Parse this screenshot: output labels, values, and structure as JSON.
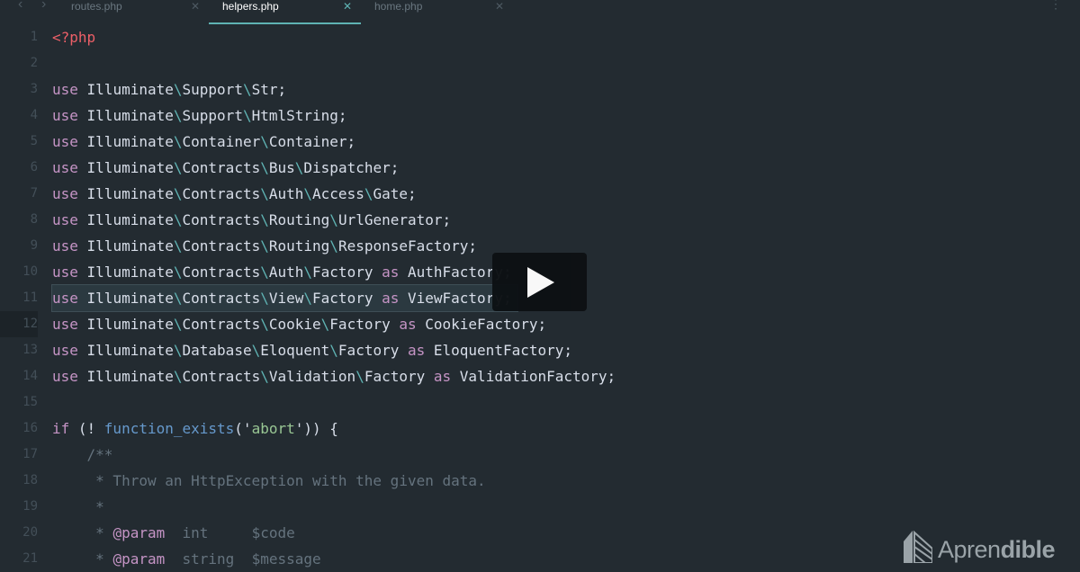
{
  "tabs": [
    {
      "label": "routes.php",
      "active": false
    },
    {
      "label": "helpers.php",
      "active": true
    },
    {
      "label": "home.php",
      "active": false
    }
  ],
  "icons": {
    "back": "chevron-left-icon",
    "forward": "chevron-right-icon",
    "close": "close-icon",
    "menu": "more-vertical-icon",
    "play": "play-icon"
  },
  "colors": {
    "background": "#232b31",
    "accent": "#5fb3b3",
    "keyword": "#c594c5",
    "string": "#99c794",
    "comment": "#65737e",
    "tag": "#ec5f67"
  },
  "brand": {
    "part1": "Apren",
    "part2": "dible"
  },
  "highlighted_line": 11,
  "cursor_line": 12,
  "lines": [
    {
      "n": "1",
      "t": [
        [
          "tag",
          "<?php"
        ]
      ]
    },
    {
      "n": "2",
      "t": []
    },
    {
      "n": "3",
      "t": [
        [
          "kw",
          "use"
        ],
        [
          "pl",
          " Illuminate"
        ],
        [
          "bs",
          "\\"
        ],
        [
          "pl",
          "Support"
        ],
        [
          "bs",
          "\\"
        ],
        [
          "pl",
          "Str;"
        ]
      ]
    },
    {
      "n": "4",
      "t": [
        [
          "kw",
          "use"
        ],
        [
          "pl",
          " Illuminate"
        ],
        [
          "bs",
          "\\"
        ],
        [
          "pl",
          "Support"
        ],
        [
          "bs",
          "\\"
        ],
        [
          "pl",
          "HtmlString;"
        ]
      ]
    },
    {
      "n": "5",
      "t": [
        [
          "kw",
          "use"
        ],
        [
          "pl",
          " Illuminate"
        ],
        [
          "bs",
          "\\"
        ],
        [
          "pl",
          "Container"
        ],
        [
          "bs",
          "\\"
        ],
        [
          "pl",
          "Container;"
        ]
      ]
    },
    {
      "n": "6",
      "t": [
        [
          "kw",
          "use"
        ],
        [
          "pl",
          " Illuminate"
        ],
        [
          "bs",
          "\\"
        ],
        [
          "pl",
          "Contracts"
        ],
        [
          "bs",
          "\\"
        ],
        [
          "pl",
          "Bus"
        ],
        [
          "bs",
          "\\"
        ],
        [
          "pl",
          "Dispatcher;"
        ]
      ]
    },
    {
      "n": "7",
      "t": [
        [
          "kw",
          "use"
        ],
        [
          "pl",
          " Illuminate"
        ],
        [
          "bs",
          "\\"
        ],
        [
          "pl",
          "Contracts"
        ],
        [
          "bs",
          "\\"
        ],
        [
          "pl",
          "Auth"
        ],
        [
          "bs",
          "\\"
        ],
        [
          "pl",
          "Access"
        ],
        [
          "bs",
          "\\"
        ],
        [
          "pl",
          "Gate;"
        ]
      ]
    },
    {
      "n": "8",
      "t": [
        [
          "kw",
          "use"
        ],
        [
          "pl",
          " Illuminate"
        ],
        [
          "bs",
          "\\"
        ],
        [
          "pl",
          "Contracts"
        ],
        [
          "bs",
          "\\"
        ],
        [
          "pl",
          "Routing"
        ],
        [
          "bs",
          "\\"
        ],
        [
          "pl",
          "UrlGenerator;"
        ]
      ]
    },
    {
      "n": "9",
      "t": [
        [
          "kw",
          "use"
        ],
        [
          "pl",
          " Illuminate"
        ],
        [
          "bs",
          "\\"
        ],
        [
          "pl",
          "Contracts"
        ],
        [
          "bs",
          "\\"
        ],
        [
          "pl",
          "Routing"
        ],
        [
          "bs",
          "\\"
        ],
        [
          "pl",
          "ResponseFactory;"
        ]
      ]
    },
    {
      "n": "10",
      "t": [
        [
          "kw",
          "use"
        ],
        [
          "pl",
          " Illuminate"
        ],
        [
          "bs",
          "\\"
        ],
        [
          "pl",
          "Contracts"
        ],
        [
          "bs",
          "\\"
        ],
        [
          "pl",
          "Auth"
        ],
        [
          "bs",
          "\\"
        ],
        [
          "pl",
          "Factory "
        ],
        [
          "kw",
          "as"
        ],
        [
          "pl",
          " AuthFactory;"
        ]
      ]
    },
    {
      "n": "11",
      "t": [
        [
          "kw",
          "use"
        ],
        [
          "pl",
          " Illuminate"
        ],
        [
          "bs",
          "\\"
        ],
        [
          "pl",
          "Contracts"
        ],
        [
          "bs",
          "\\"
        ],
        [
          "pl",
          "View"
        ],
        [
          "bs",
          "\\"
        ],
        [
          "pl",
          "Factory "
        ],
        [
          "kw",
          "as"
        ],
        [
          "pl",
          " ViewFactory;"
        ]
      ]
    },
    {
      "n": "12",
      "t": [
        [
          "kw",
          "use"
        ],
        [
          "pl",
          " Illuminate"
        ],
        [
          "bs",
          "\\"
        ],
        [
          "pl",
          "Contracts"
        ],
        [
          "bs",
          "\\"
        ],
        [
          "pl",
          "Cookie"
        ],
        [
          "bs",
          "\\"
        ],
        [
          "pl",
          "Factory "
        ],
        [
          "kw",
          "as"
        ],
        [
          "pl",
          " CookieFactory;"
        ]
      ]
    },
    {
      "n": "13",
      "t": [
        [
          "kw",
          "use"
        ],
        [
          "pl",
          " Illuminate"
        ],
        [
          "bs",
          "\\"
        ],
        [
          "pl",
          "Database"
        ],
        [
          "bs",
          "\\"
        ],
        [
          "pl",
          "Eloquent"
        ],
        [
          "bs",
          "\\"
        ],
        [
          "pl",
          "Factory "
        ],
        [
          "kw",
          "as"
        ],
        [
          "pl",
          " EloquentFactory;"
        ]
      ]
    },
    {
      "n": "14",
      "t": [
        [
          "kw",
          "use"
        ],
        [
          "pl",
          " Illuminate"
        ],
        [
          "bs",
          "\\"
        ],
        [
          "pl",
          "Contracts"
        ],
        [
          "bs",
          "\\"
        ],
        [
          "pl",
          "Validation"
        ],
        [
          "bs",
          "\\"
        ],
        [
          "pl",
          "Factory "
        ],
        [
          "kw",
          "as"
        ],
        [
          "pl",
          " ValidationFactory;"
        ]
      ]
    },
    {
      "n": "15",
      "t": []
    },
    {
      "n": "16",
      "t": [
        [
          "kw",
          "if"
        ],
        [
          "pl",
          " (! "
        ],
        [
          "fn",
          "function_exists"
        ],
        [
          "pl",
          "('"
        ],
        [
          "st",
          "abort"
        ],
        [
          "pl",
          "')) {"
        ]
      ]
    },
    {
      "n": "17",
      "t": [
        [
          "cm",
          "    /**"
        ]
      ]
    },
    {
      "n": "18",
      "t": [
        [
          "cm",
          "     * Throw an HttpException with the given data."
        ]
      ]
    },
    {
      "n": "19",
      "t": [
        [
          "cm",
          "     *"
        ]
      ]
    },
    {
      "n": "20",
      "t": [
        [
          "cm",
          "     * "
        ],
        [
          "kw",
          "@param"
        ],
        [
          "cm",
          "  int     $code"
        ]
      ]
    },
    {
      "n": "21",
      "t": [
        [
          "cm",
          "     * "
        ],
        [
          "kw",
          "@param"
        ],
        [
          "cm",
          "  string  $message"
        ]
      ]
    }
  ]
}
